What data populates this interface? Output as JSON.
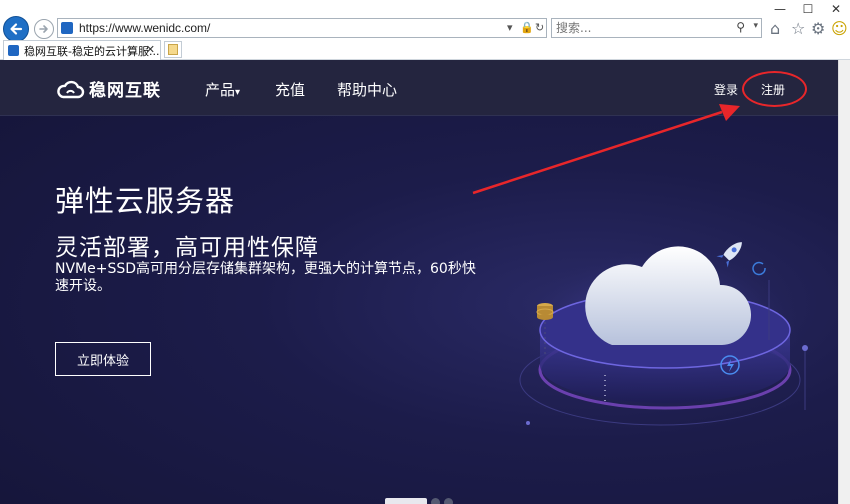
{
  "browser": {
    "url": "https://www.wenidc.com/",
    "search_placeholder": "搜索...",
    "tab_title": "稳网互联-稳定的云计算服...",
    "window_controls": [
      "—",
      "☐",
      "✕"
    ],
    "toolbar_icons": [
      "home-icon",
      "star-icon",
      "gear-icon",
      "smiley-icon"
    ]
  },
  "site": {
    "logo_text": "稳网互联",
    "nav": {
      "products": "产品",
      "products_caret": "▾",
      "recharge": "充值",
      "help": "帮助中心",
      "login": "登录",
      "register": "注册"
    },
    "hero": {
      "title": "弹性云服务器",
      "subtitle": "灵活部署，高可用性保障",
      "description": "NVMe+SSD高可用分层存储集群架构，更强大的计算节点，60秒快速开设。",
      "cta": "立即体验"
    },
    "carousel": {
      "slides": 3,
      "active": 1
    }
  },
  "annotation": {
    "color": "#e8262a",
    "target": "register"
  }
}
